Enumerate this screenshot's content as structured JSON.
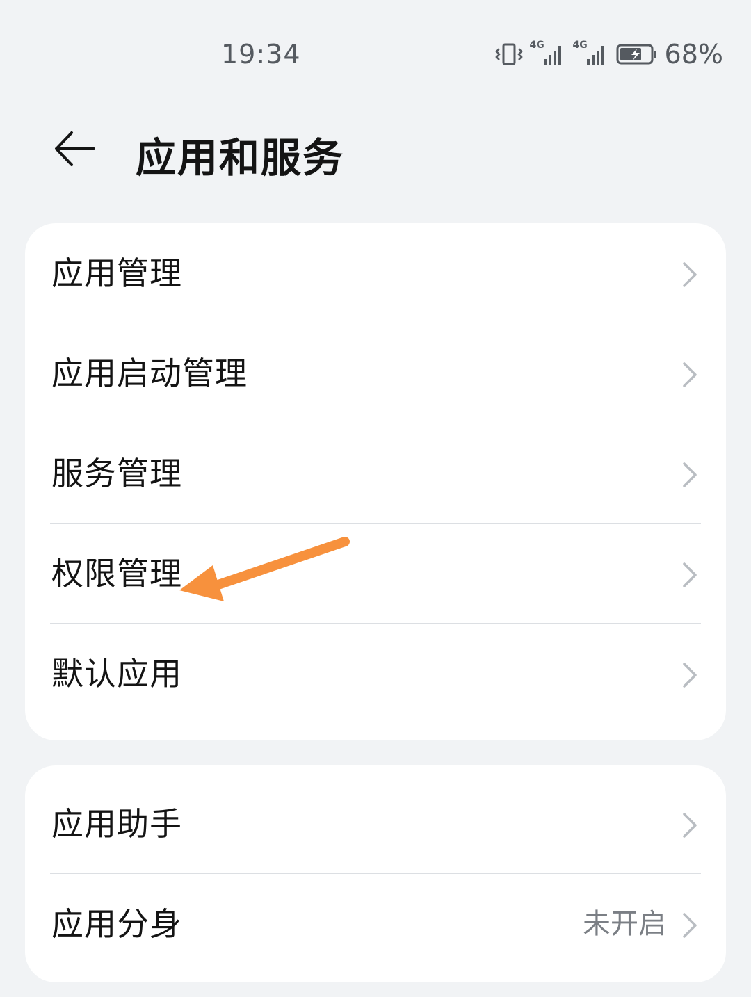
{
  "status_bar": {
    "time": "19:34",
    "network_1": "4G",
    "network_2": "4G",
    "battery_percent": "68%"
  },
  "header": {
    "title": "应用和服务"
  },
  "group_1": {
    "items": [
      {
        "label": "应用管理"
      },
      {
        "label": "应用启动管理"
      },
      {
        "label": "服务管理"
      },
      {
        "label": "权限管理"
      },
      {
        "label": "默认应用"
      }
    ]
  },
  "group_2": {
    "items": [
      {
        "label": "应用助手"
      },
      {
        "label": "应用分身",
        "value": "未开启"
      }
    ]
  },
  "colors": {
    "background": "#f1f3f5",
    "card": "#ffffff",
    "annotation_arrow": "#f7913d"
  }
}
